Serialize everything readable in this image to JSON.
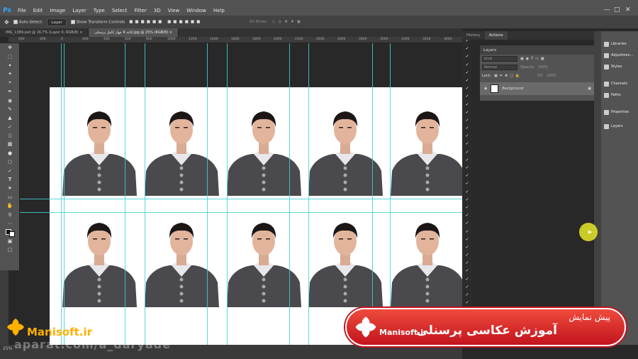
{
  "app": {
    "logo": "Ps"
  },
  "menu": [
    "File",
    "Edit",
    "Image",
    "Layer",
    "Type",
    "Select",
    "Filter",
    "3D",
    "View",
    "Window",
    "Help"
  ],
  "options": {
    "auto_select_label": "Auto-Select:",
    "auto_select_value": "Layer",
    "transform_label": "Show Transform Controls",
    "mode_3d": "3D Mode:"
  },
  "tabs": [
    {
      "label": "IMG_1389.psd @ 16.7% (Layer 0, RGB/8)"
    },
    {
      "label": "کاغذ 4 چهار کامل پرسنلی.jpg @ 25% (RGB/8)"
    }
  ],
  "ruler_ticks": [
    "400",
    "200",
    "0",
    "200",
    "400",
    "600",
    "800",
    "1000",
    "1200",
    "1400",
    "1600",
    "1800",
    "2000",
    "2200",
    "2400",
    "2600",
    "2800",
    "3000",
    "3200",
    "3400",
    "3600"
  ],
  "panel_tabs": [
    "History",
    "Actions"
  ],
  "layers": {
    "title": "Layers",
    "kind": "Kind",
    "mode": "Normal",
    "opacity_label": "Opacity:",
    "opacity": "100%",
    "lock_label": "Lock:",
    "fill_label": "Fill:",
    "fill": "100%",
    "background_label": "Background"
  },
  "dock": [
    {
      "label": "Libraries"
    },
    {
      "label": "Adjustmen..."
    },
    {
      "label": "Styles"
    },
    {
      "label": "Channels"
    },
    {
      "label": "Paths"
    },
    {
      "label": "Properties"
    },
    {
      "label": "Layers"
    }
  ],
  "status": {
    "zoom": "25%"
  },
  "banner": {
    "title": "پیش نمایش",
    "subtitle": "آموزش عکاسی پرسنلی",
    "brand": "Manisoft.ir"
  },
  "watermark": {
    "brand": "Manisoft.ir",
    "handle": "aparat.com/a_daryade"
  },
  "colors": {
    "accent": "#31a8ff",
    "guide": "#3fd0d6",
    "banner": "#d7252b",
    "logo_orange": "#ffb000"
  }
}
